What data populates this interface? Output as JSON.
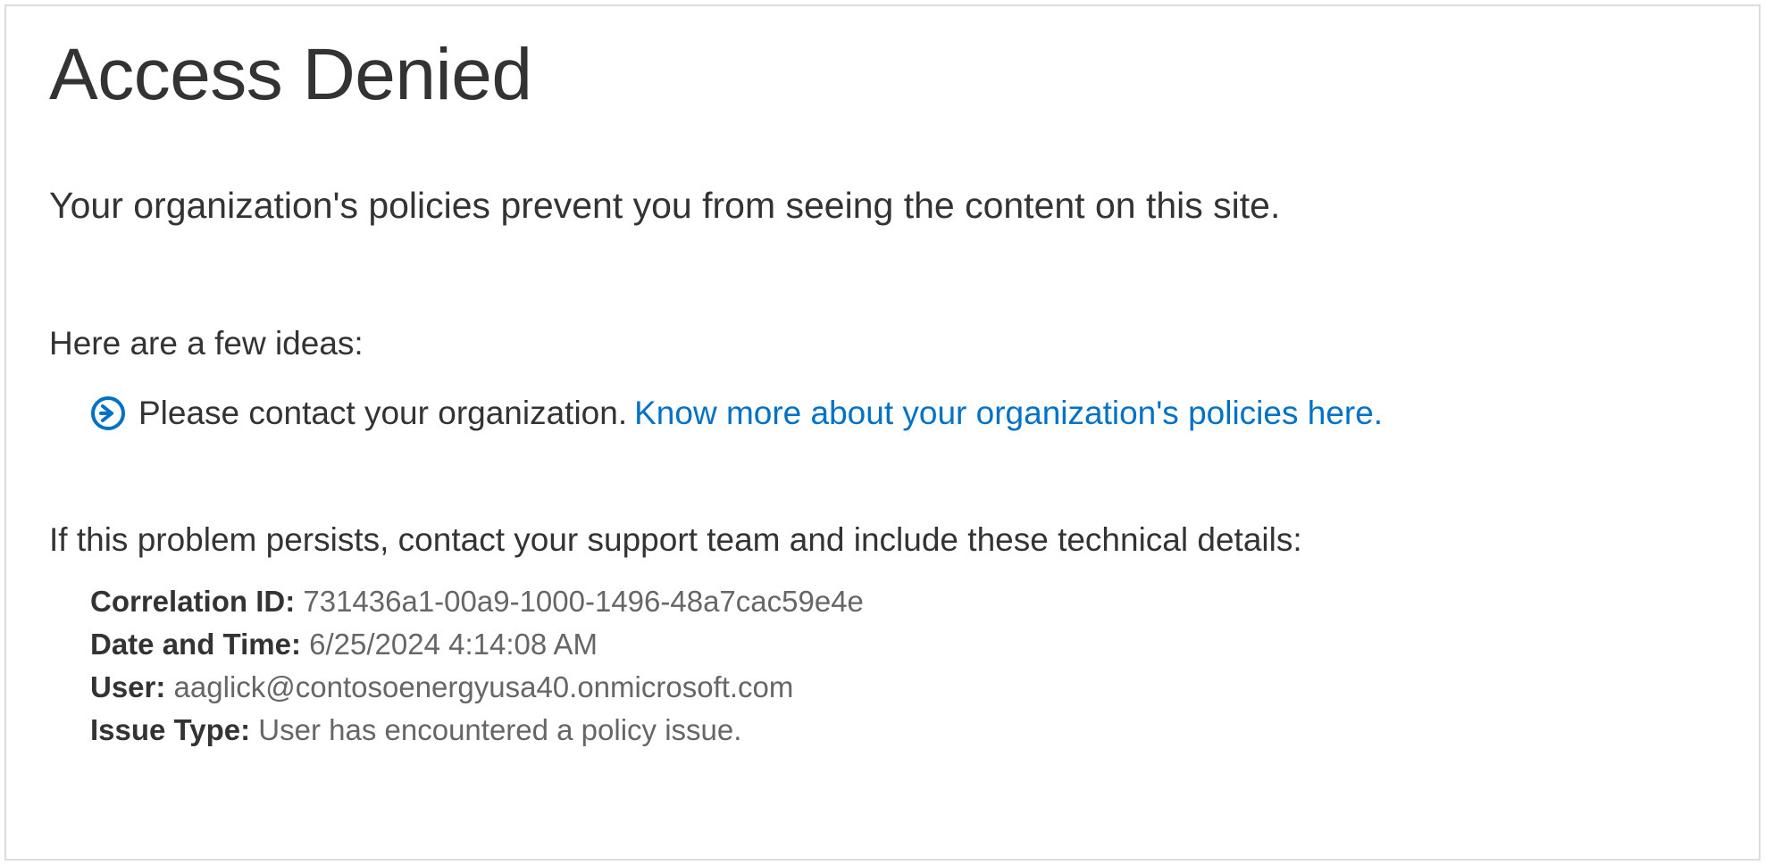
{
  "title": "Access Denied",
  "message": "Your organization's policies prevent you from seeing the content on this site.",
  "ideas_heading": "Here are a few ideas:",
  "idea": {
    "text": "Please contact your organization.",
    "link_text": "Know more about your organization's policies here."
  },
  "support_heading": "If this problem persists, contact your support team and include these technical details:",
  "details": {
    "correlation_id_label": "Correlation ID:",
    "correlation_id_value": "731436a1-00a9-1000-1496-48a7cac59e4e",
    "date_time_label": "Date and Time:",
    "date_time_value": "6/25/2024 4:14:08 AM",
    "user_label": "User:",
    "user_value": "aaglick@contosoenergyusa40.onmicrosoft.com",
    "issue_type_label": "Issue Type:",
    "issue_type_value": "User has encountered a policy issue."
  },
  "colors": {
    "link": "#0072c6",
    "border": "#dcdcdc",
    "text_primary": "#333333",
    "text_secondary": "#666666"
  }
}
